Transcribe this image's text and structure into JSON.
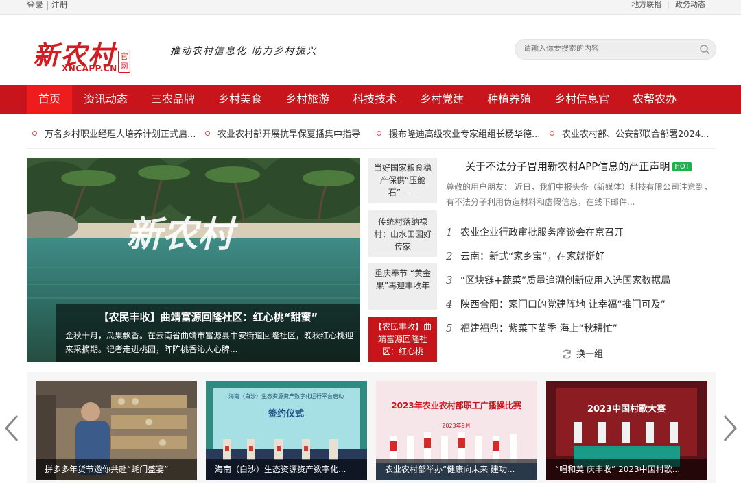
{
  "topbar": {
    "login": "登录",
    "separator": "|",
    "register": "注册",
    "links": [
      "地方联播",
      "政务动态"
    ]
  },
  "header": {
    "logo_cn": "新农村",
    "logo_en": "XNCAPP.CN",
    "logo_badge": "官网",
    "slogan": "推动农村信息化 助力乡村振兴",
    "search_placeholder": "请输入你要搜索的内容"
  },
  "nav": {
    "items": [
      "首页",
      "资讯动态",
      "三农品牌",
      "乡村美食",
      "乡村旅游",
      "科技技术",
      "乡村党建",
      "种植养殖",
      "乡村信息官",
      "农帮农办"
    ],
    "active": "首页"
  },
  "ticker": [
    "万名乡村职业经理人培养计划正式启...",
    "农业农村部开展抗旱保夏播集中指导",
    "援布隆迪高级农业专家组组长杨华德...",
    "农业农村部、公安部联合部署2024..."
  ],
  "hero": {
    "watermark": "新农村",
    "title": "【农民丰收】曲靖富源回隆社区：红心桃“甜蜜”",
    "summary": "金秋十月，瓜果飘香。在云南省曲靖市富源县中安街道回隆社区，晚秋红心桃迎来采摘期。记者走进桃园，阵阵桃香沁人心脾..."
  },
  "side_items": [
    "当好国家粮食稳产保供“压舱石”——",
    "传统村落纳禄村：山水田园好传家",
    "重庆奉节 “黄金果”再迎丰收年",
    "【农民丰收】曲靖富源回隆社区：红心桃"
  ],
  "feature": {
    "title": "关于不法分子冒用新农村APP信息的严正声明",
    "hot": "HOT",
    "desc": "尊敬的用户朋友：  近日，我们中报头条（新媒体）科技有限公司注意到，有不法分子利用伪造材料和虚假信息，在线下邮件..."
  },
  "news": [
    {
      "num": "1",
      "text": "农业企业行政审批服务座谈会在京召开"
    },
    {
      "num": "2",
      "text": "云南：新式“家乡宝”，在家就挺好"
    },
    {
      "num": "3",
      "text": "“区块链+蔬菜”质量追溯创新应用入选国家数据局"
    },
    {
      "num": "4",
      "text": "陕西合阳：家门口的党建阵地 让幸福“推门可及”"
    },
    {
      "num": "5",
      "text": "福建福鼎：紫菜下苗季 海上“秋耕忙”"
    }
  ],
  "swap_label": "换一组",
  "cards": [
    {
      "caption": "拼多多年货节邀你共赴“蚝门盛宴”"
    },
    {
      "caption": "海南（白沙）生态资源资产数字化..."
    },
    {
      "caption": "农业农村部举办“健康向未来 建功..."
    },
    {
      "caption": "“唱和美 庆丰收” 2023中国村歌..."
    }
  ],
  "card_texts": {
    "card2_banner": "海南（白沙）生态资源资产数字化运行平台启动",
    "card2_sign": "签约仪式",
    "card3_title": "2023年农业农村部职工广播操比赛",
    "card3_date": "2023年9月",
    "card4_title": "2023中国村歌大赛"
  },
  "colors": {
    "brand_red": "#c8141b",
    "nav_active": "#ee1c1c",
    "hot_green": "#1cb34c"
  }
}
